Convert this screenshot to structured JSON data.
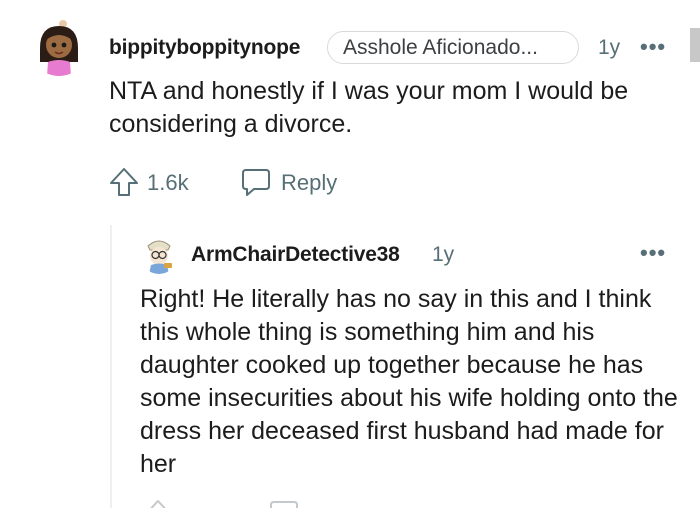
{
  "comments": [
    {
      "username": "bippityboppitynope",
      "flair": "Asshole Aficionado...",
      "age": "1y",
      "body": "NTA and honestly if I was your mom I would be considering a divorce.",
      "upvotes": "1.6k",
      "reply_label": "Reply"
    },
    {
      "username": "ArmChairDetective38",
      "age": "1y",
      "body": "Right! He literally has no say in this and I think this whole thing is something him and his daughter cooked up together because he has some insecurities about his wife holding onto the dress her deceased first husband had made for her"
    }
  ],
  "icons": {
    "more": "more-options-icon",
    "upvote": "upvote-arrow-icon",
    "reply": "reply-bubble-icon"
  }
}
